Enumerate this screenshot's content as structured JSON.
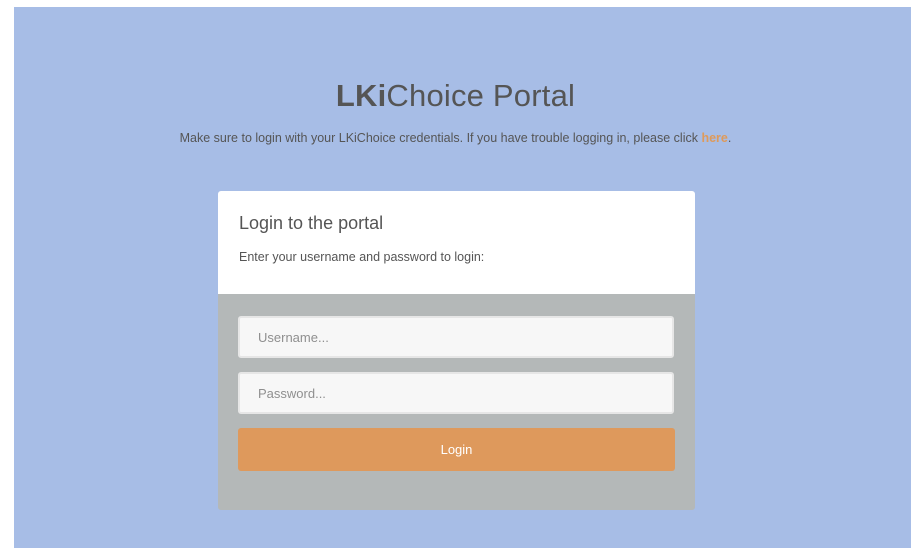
{
  "header": {
    "title_bold": "LKi",
    "title_rest": "Choice Portal",
    "subtitle_text": "Make sure to login with your LKiChoice credentials. If you have trouble logging in, please click ",
    "subtitle_link": "here",
    "subtitle_end": "."
  },
  "login_card": {
    "title": "Login to the portal",
    "description": "Enter your username and password to login:",
    "username_placeholder": "Username...",
    "username_value": "",
    "password_placeholder": "Password...",
    "password_value": "",
    "login_label": "Login"
  },
  "colors": {
    "background": "#a7bde6",
    "accent": "#de995c",
    "form_panel": "#b4b8b8"
  }
}
